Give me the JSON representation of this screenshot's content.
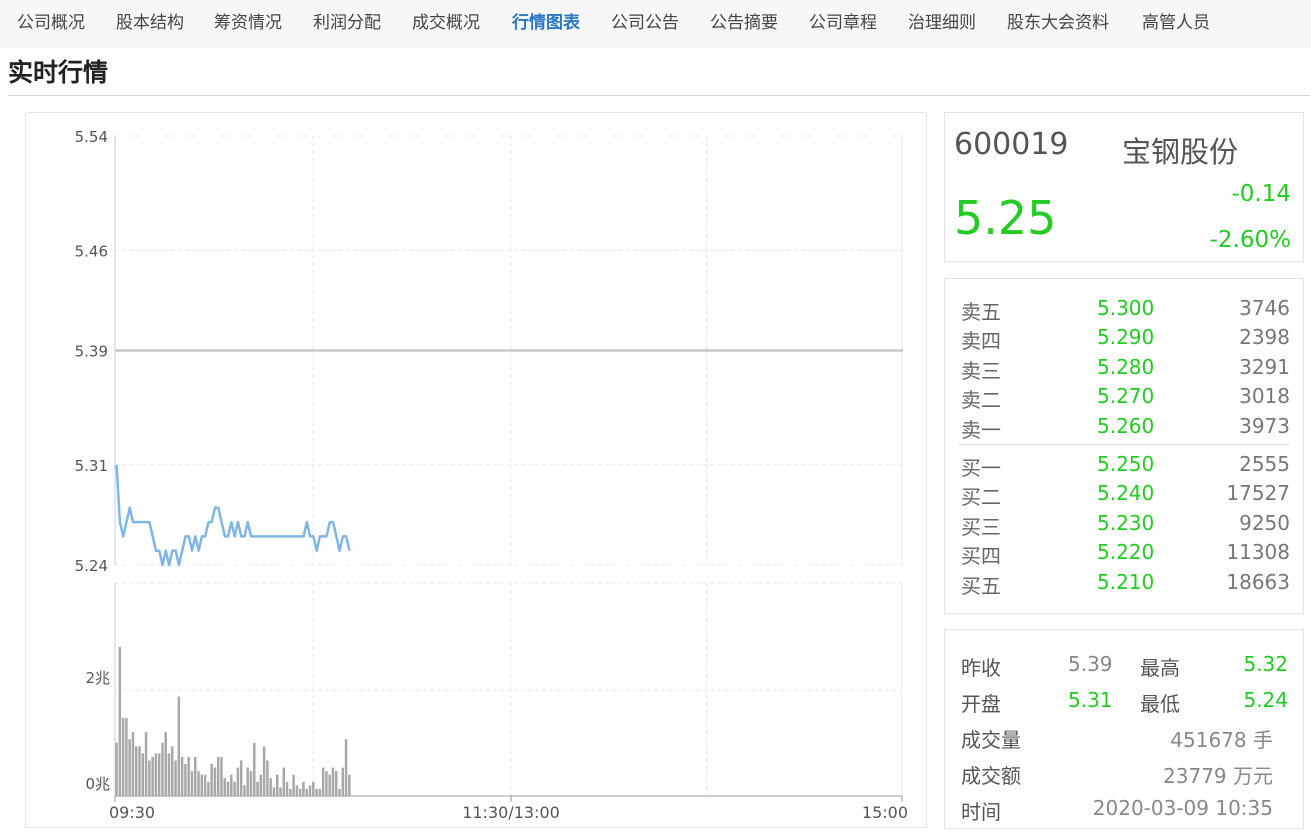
{
  "nav": {
    "tabs": [
      {
        "label": "公司概况"
      },
      {
        "label": "股本结构"
      },
      {
        "label": "筹资情况"
      },
      {
        "label": "利润分配"
      },
      {
        "label": "成交概况"
      },
      {
        "label": "行情图表",
        "active": true
      },
      {
        "label": "公司公告"
      },
      {
        "label": "公告摘要"
      },
      {
        "label": "公司章程"
      },
      {
        "label": "治理细则"
      },
      {
        "label": "股东大会资料"
      },
      {
        "label": "高管人员"
      }
    ]
  },
  "page_title": "实时行情",
  "colors": {
    "accent": "#2b78c2",
    "down": "#22cc22",
    "price_line": "#7fb6e6",
    "volume_bar": "#a8a8a8",
    "prev_close_line": "#c8c8c8"
  },
  "quote": {
    "code": "600019",
    "name": "宝钢股份",
    "price": "5.25",
    "change": "-0.14",
    "change_pct": "-2.60%"
  },
  "order_book": {
    "asks": [
      {
        "label": "卖五",
        "price": "5.300",
        "volume": "3746"
      },
      {
        "label": "卖四",
        "price": "5.290",
        "volume": "2398"
      },
      {
        "label": "卖三",
        "price": "5.280",
        "volume": "3291"
      },
      {
        "label": "卖二",
        "price": "5.270",
        "volume": "3018"
      },
      {
        "label": "卖一",
        "price": "5.260",
        "volume": "3973"
      }
    ],
    "bids": [
      {
        "label": "买一",
        "price": "5.250",
        "volume": "2555"
      },
      {
        "label": "买二",
        "price": "5.240",
        "volume": "17527"
      },
      {
        "label": "买三",
        "price": "5.230",
        "volume": "9250"
      },
      {
        "label": "买四",
        "price": "5.220",
        "volume": "11308"
      },
      {
        "label": "买五",
        "price": "5.210",
        "volume": "18663"
      }
    ]
  },
  "stats": {
    "prev_close_label": "昨收",
    "prev_close": "5.39",
    "high_label": "最高",
    "high": "5.32",
    "open_label": "开盘",
    "open": "5.31",
    "low_label": "最低",
    "low": "5.24",
    "volume_label": "成交量",
    "volume": "451678 手",
    "amount_label": "成交额",
    "amount": "23779 万元",
    "time_label": "时间",
    "time": "2020-03-09 10:35"
  },
  "chart_data": {
    "type": "line",
    "price_axis": {
      "ticks": [
        "5.54",
        "5.46",
        "5.39",
        "5.31",
        "5.24"
      ],
      "range": [
        5.24,
        5.54
      ]
    },
    "volume_axis": {
      "ticks": [
        "2兆",
        "0兆"
      ],
      "range": [
        0,
        3
      ]
    },
    "x_ticks": [
      "09:30",
      "11:30/13:00",
      "15:00"
    ],
    "reference_price": 5.39,
    "price": [
      5.31,
      5.27,
      5.26,
      5.27,
      5.28,
      5.27,
      5.27,
      5.27,
      5.27,
      5.27,
      5.27,
      5.26,
      5.25,
      5.25,
      5.24,
      5.25,
      5.24,
      5.25,
      5.25,
      5.24,
      5.25,
      5.26,
      5.26,
      5.25,
      5.26,
      5.25,
      5.26,
      5.26,
      5.27,
      5.27,
      5.28,
      5.28,
      5.27,
      5.26,
      5.26,
      5.27,
      5.26,
      5.27,
      5.26,
      5.26,
      5.27,
      5.26,
      5.26,
      5.26,
      5.26,
      5.26,
      5.26,
      5.26,
      5.26,
      5.26,
      5.26,
      5.26,
      5.26,
      5.26,
      5.26,
      5.26,
      5.26,
      5.26,
      5.27,
      5.26,
      5.26,
      5.25,
      5.26,
      5.26,
      5.26,
      5.27,
      5.27,
      5.26,
      5.25,
      5.26,
      5.26,
      5.25
    ],
    "volume": [
      0.75,
      2.1,
      1.1,
      1.1,
      0.8,
      0.9,
      0.7,
      0.7,
      0.6,
      0.9,
      0.5,
      0.55,
      0.6,
      0.6,
      0.75,
      0.9,
      0.6,
      0.7,
      0.5,
      1.4,
      0.55,
      0.45,
      0.55,
      0.35,
      0.55,
      0.35,
      0.3,
      0.3,
      0.2,
      0.45,
      0.4,
      0.55,
      0.55,
      0.25,
      0.2,
      0.3,
      0.2,
      0.4,
      0.5,
      0.15,
      0.4,
      0.35,
      0.75,
      0.2,
      0.3,
      0.7,
      0.5,
      0.25,
      0.12,
      0.3,
      0.12,
      0.4,
      0.2,
      0.1,
      0.3,
      0.15,
      0.1,
      0.2,
      0.1,
      0.15,
      0.2,
      0.1,
      0.1,
      0.4,
      0.35,
      0.3,
      0.4,
      0.35,
      0.1,
      0.4,
      0.8,
      0.3
    ]
  }
}
